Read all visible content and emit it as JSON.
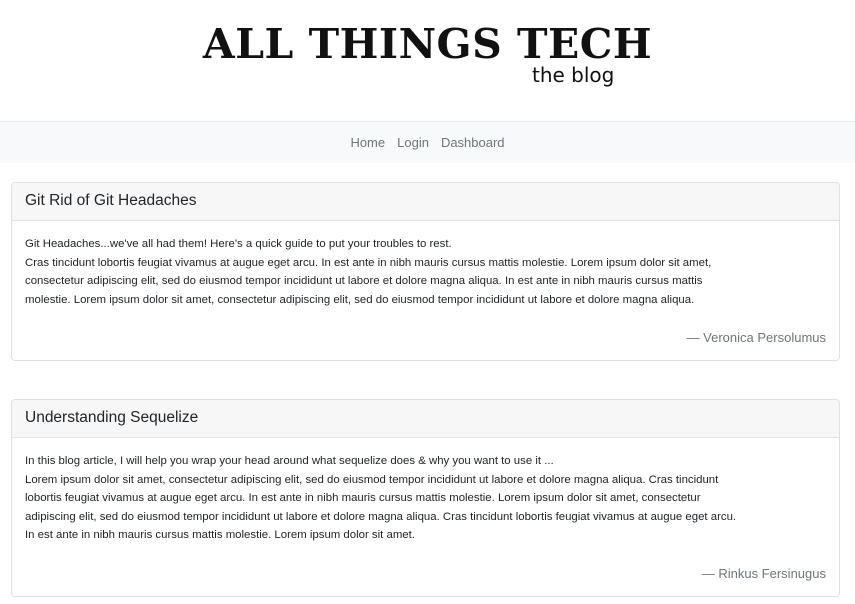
{
  "header": {
    "title": "ALL THINGS TECH",
    "subtitle": "the blog"
  },
  "nav": {
    "items": [
      "Home",
      "Login",
      "Dashboard"
    ]
  },
  "posts": [
    {
      "title": "Git Rid of Git Headaches",
      "lines": [
        "Git Headaches...we've all had them! Here's a quick guide to put your troubles to rest.",
        "Cras tincidunt lobortis feugiat vivamus at augue eget arcu. In est ante in nibh mauris cursus mattis molestie. Lorem ipsum dolor sit amet,",
        "consectetur adipiscing elit, sed do eiusmod tempor incididunt ut labore et dolore magna aliqua. In est ante in nibh mauris cursus mattis",
        "molestie. Lorem ipsum dolor sit amet, consectetur adipiscing elit, sed do eiusmod tempor incididunt ut labore et dolore magna aliqua."
      ],
      "author": "— Veronica Persolumus"
    },
    {
      "title": "Understanding Sequelize",
      "lines": [
        "In this blog article, I will help you wrap your head around what sequelize does & why you want to use it ...",
        "Lorem ipsum dolor sit amet, consectetur adipiscing elit, sed do eiusmod tempor incididunt ut labore et dolore magna aliqua. Cras tincidunt",
        "lobortis feugiat vivamus at augue eget arcu. In est ante in nibh mauris cursus mattis molestie. Lorem ipsum dolor sit amet, consectetur",
        "adipiscing elit, sed do eiusmod tempor incididunt ut labore et dolore magna aliqua. Cras tincidunt lobortis feugiat vivamus at augue eget arcu.",
        "In est ante in nibh mauris cursus mattis molestie. Lorem ipsum dolor sit amet."
      ],
      "author": "— Rinkus Fersinugus"
    }
  ]
}
